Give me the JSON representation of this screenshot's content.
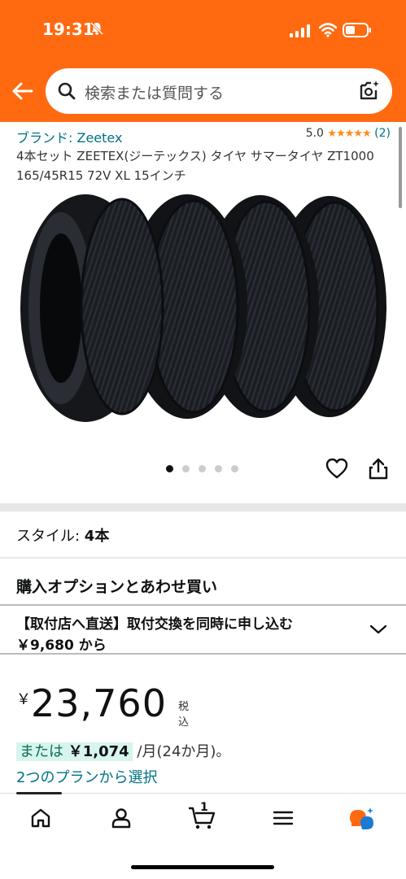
{
  "status": {
    "time": "19:31"
  },
  "search": {
    "placeholder": "検索または質問する"
  },
  "product": {
    "brand": "ブランド: Zeetex",
    "rating": "5.0",
    "stars": "★★★★★",
    "rating_count": "(2)",
    "title": "4本セット ZEETEX(ジーテックス) タイヤ サマータイヤ ZT1000 165/45R15 72V XL 15インチ"
  },
  "gallery": {
    "image_count": 5,
    "active_index": 0
  },
  "style": {
    "label": "スタイル: ",
    "value": "4本"
  },
  "options": {
    "heading": "購入オプションとあわせ買い",
    "line1": "【取付店へ直送】取付交換を同時に申し込む",
    "line2": "￥9,680 から"
  },
  "price": {
    "currency": "￥",
    "amount": "23,760",
    "tax_label": "税込",
    "installment_prefix": "または",
    "installment_amount": "￥1,074",
    "installment_suffix": "/月(24か月)。",
    "plans_link": "2つのプランから選択"
  },
  "tabbar": {
    "items": [
      "home-icon",
      "account-icon",
      "cart-icon",
      "menu-icon",
      "rufus-icon"
    ],
    "cart_count": "1"
  },
  "colors": {
    "header": "#ff6a11",
    "link": "#007185",
    "star": "#ff8c19",
    "installment_bg": "#d7f4ee"
  }
}
